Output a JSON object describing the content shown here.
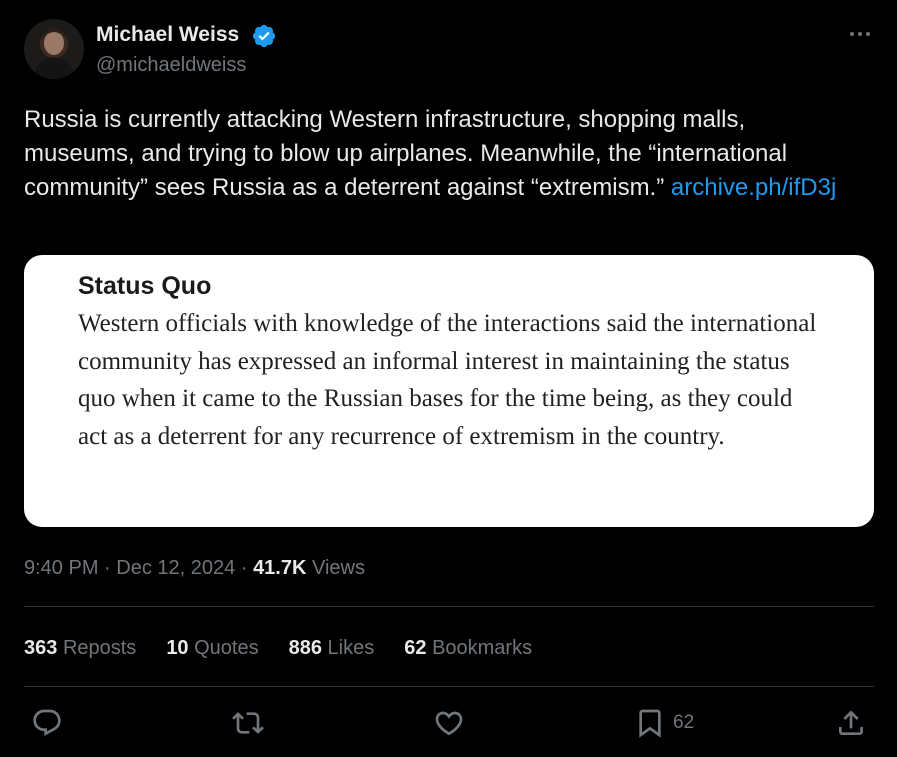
{
  "author": {
    "name": "Michael Weiss",
    "handle": "@michaeldweiss",
    "verified": true
  },
  "tweet": {
    "text": "Russia is currently attacking Western infrastructure, shopping malls, museums, and trying to blow up airplanes. Meanwhile, the “international community” sees Russia as a deterrent against “extremism.”",
    "link_text": "archive.ph/ifD3j"
  },
  "quote_image": {
    "heading": "Status Quo",
    "body": "Western officials with knowledge of the interactions said the international community has expressed an informal interest in maintaining the status quo when it came to the Russian bases for the time being, as they could act as a deterrent for any recurrence of extremism in the country."
  },
  "meta": {
    "time": "9:40 PM",
    "separator": "·",
    "date": "Dec 12, 2024",
    "views_count": "41.7K",
    "views_label": "Views"
  },
  "stats": [
    {
      "count": "363",
      "label": "Reposts"
    },
    {
      "count": "10",
      "label": "Quotes"
    },
    {
      "count": "886",
      "label": "Likes"
    },
    {
      "count": "62",
      "label": "Bookmarks"
    }
  ],
  "actions": {
    "reply_icon": "reply-icon",
    "repost_icon": "repost-icon",
    "like_icon": "like-icon",
    "bookmark_icon": "bookmark-icon",
    "bookmark_count": "62",
    "share_icon": "share-icon"
  },
  "colors": {
    "background": "#000000",
    "text_primary": "#e7e9ea",
    "text_secondary": "#71767b",
    "link": "#1d9bf0",
    "verified_badge": "#1d9bf0",
    "divider": "#2f3336"
  }
}
